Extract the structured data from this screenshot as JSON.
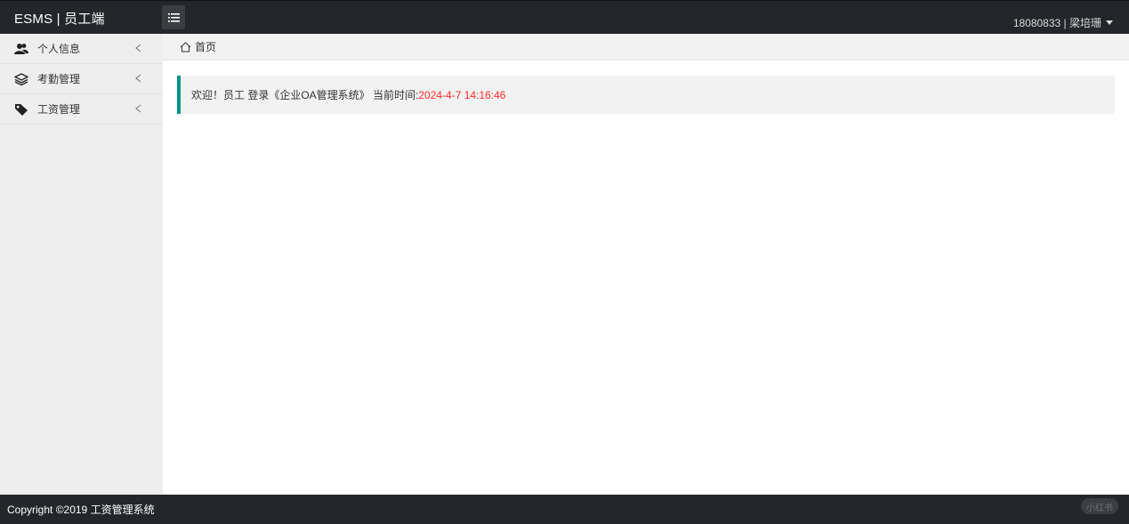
{
  "header": {
    "title": "ESMS | 员工端",
    "user": "18080833 | 梁培珊"
  },
  "sidebar": {
    "items": [
      {
        "label": "个人信息",
        "icon": "users-icon"
      },
      {
        "label": "考勤管理",
        "icon": "layers-icon"
      },
      {
        "label": "工资管理",
        "icon": "tag-icon"
      }
    ]
  },
  "breadcrumb": {
    "home": "首页"
  },
  "welcome": {
    "text": "欢迎！员工 登录《企业OA管理系统》 当前时间:",
    "time": "2024-4-7 14:16:46"
  },
  "footer": {
    "copyright": "Copyright ©2019 工资管理系统",
    "watermark": "小红书"
  },
  "colors": {
    "header_bg": "#23262b",
    "accent": "#009688",
    "time_color": "#ff2a2a"
  }
}
